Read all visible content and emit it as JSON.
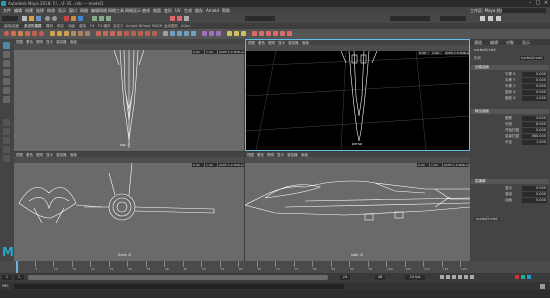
{
  "window": {
    "title": "Autodesk Maya 2018: F:\\...\\F-35...mb  ---  model1"
  },
  "menus": [
    "文件",
    "编辑",
    "创建",
    "选择",
    "修改",
    "显示",
    "窗口",
    "网格",
    "编辑网格",
    "网格工具",
    "网格显示",
    "曲线",
    "曲面",
    "变形",
    "UV",
    "生成",
    "缓存",
    "Arnold",
    "帮助"
  ],
  "workspace_label": "工作区: Maya 经典",
  "shelf_tabs": [
    "曲线/曲面",
    "多边形建模",
    "雕刻",
    "绑定",
    "动画",
    "渲染",
    "FX",
    "FX 缓存",
    "自定义",
    "Arnold",
    "Bifrost",
    "MASH",
    "运动图形",
    "XGen"
  ],
  "viewports": [
    {
      "label": "top -Y",
      "menus": [
        "视图",
        "着色",
        "照明",
        "显示",
        "渲染器",
        "面板"
      ],
      "near": "0.00",
      "far": "1.00",
      "gamma": "ACES 1.0 SDR-video (sRGB)"
    },
    {
      "label": "persp",
      "menus": [
        "视图",
        "着色",
        "照明",
        "显示",
        "渲染器",
        "面板"
      ],
      "near": "0.00",
      "far": "1.00",
      "gamma": "ACES 1.0 SDR-video (sRGB)"
    },
    {
      "label": "front -Z",
      "menus": [
        "视图",
        "着色",
        "照明",
        "显示",
        "渲染器",
        "面板"
      ],
      "near": "0.00",
      "far": "1.00",
      "gamma": "ACES 1.0 SDR-video (sRGB)"
    },
    {
      "label": "side -X",
      "menus": [
        "视图",
        "着色",
        "照明",
        "显示",
        "渲染器",
        "面板"
      ],
      "near": "0.00",
      "far": "1.00",
      "gamma": "ACES 1.0 SDR-video (sRGB)"
    }
  ],
  "channel_box": {
    "tabs": [
      "通道",
      "编辑",
      "对象",
      "显示"
    ],
    "object_name": "nurbsCircle1",
    "shape_label": "形状",
    "sections": [
      {
        "title": "创建曲面",
        "attrs": [
          {
            "label": "平移 X",
            "value": "0.000"
          },
          {
            "label": "平移 Y",
            "value": "0.000"
          },
          {
            "label": "平移 Z",
            "value": "0.000"
          },
          {
            "label": "旋转 X",
            "value": "0.000"
          },
          {
            "label": "缩放 X",
            "value": "1.000"
          }
        ]
      },
      {
        "title": "输出曲面",
        "attrs": [
          {
            "label": "度数",
            "value": "3.000"
          },
          {
            "label": "分段",
            "value": "8.000"
          },
          {
            "label": "开始扫描",
            "value": "0.000"
          },
          {
            "label": "结束扫描",
            "value": "360.000"
          },
          {
            "label": "半径",
            "value": "1.000"
          }
        ]
      },
      {
        "title": "层编辑",
        "attrs": [
          {
            "label": "显示",
            "value": "0.000"
          },
          {
            "label": "渲染",
            "value": "0.000"
          },
          {
            "label": "动画",
            "value": "0.000"
          }
        ]
      }
    ],
    "layer_name": "nurbsCircle1"
  },
  "timeline": {
    "ticks": [
      "1",
      "5",
      "10",
      "15",
      "20",
      "25",
      "30",
      "35",
      "40",
      "45",
      "50",
      "55",
      "60",
      "65",
      "70",
      "75",
      "80",
      "85",
      "90",
      "95",
      "100",
      "105",
      "110",
      "115",
      "120"
    ],
    "current_frame": "1"
  },
  "range": {
    "start": "1",
    "inner_start": "1",
    "inner_end": "24",
    "end": "48",
    "fps": "24 fps"
  },
  "cmd": {
    "label": "MEL"
  },
  "colors": {
    "accent": "#5285a6",
    "active_border": "#62c0e8"
  }
}
